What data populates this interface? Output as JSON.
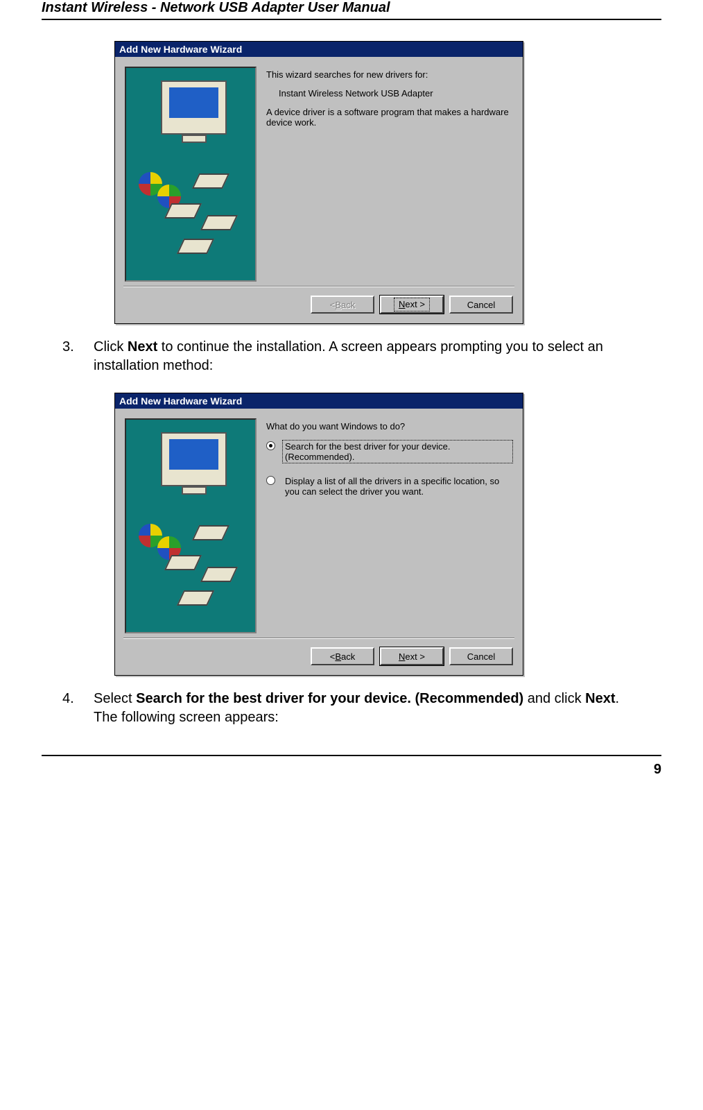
{
  "doc": {
    "header": "Instant Wireless - Network USB Adapter User Manual",
    "page_number": "9"
  },
  "steps": {
    "s3": {
      "num": "3.",
      "pre": "Click ",
      "bold1": "Next",
      "post": " to continue the installation. A screen appears prompting you to select an installation method:"
    },
    "s4": {
      "num": "4.",
      "pre": "Select ",
      "bold1": "Search for the best driver for your device. (Recommended)",
      "mid": " and click ",
      "bold2": "Next",
      "post": ".   The following screen appears:"
    }
  },
  "wizard1": {
    "title": "Add New Hardware Wizard",
    "line1": "This wizard searches for new drivers for:",
    "line2": "Instant Wireless Network USB Adapter",
    "line3": "A device driver is a software program that makes a hardware device work.",
    "buttons": {
      "back_prefix": "< ",
      "back_letter": "B",
      "back_rest": "ack",
      "next_prefix": "",
      "next_letter": "N",
      "next_rest": "ext >",
      "cancel": "Cancel"
    }
  },
  "wizard2": {
    "title": "Add New Hardware Wizard",
    "prompt": "What do you want Windows to do?",
    "opt1": "Search for the best driver for your device. (Recommended).",
    "opt2": "Display a list of all the drivers in a specific location, so you can select the driver you want.",
    "buttons": {
      "back_prefix": "< ",
      "back_letter": "B",
      "back_rest": "ack",
      "next_prefix": "",
      "next_letter": "N",
      "next_rest": "ext >",
      "cancel": "Cancel"
    }
  }
}
